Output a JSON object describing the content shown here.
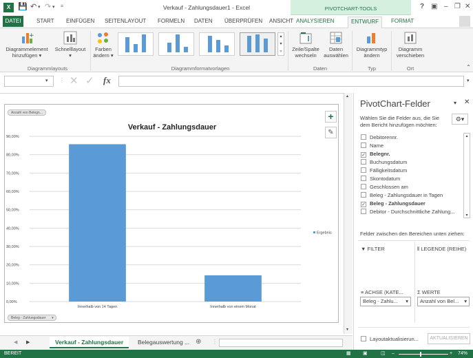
{
  "window": {
    "title": "Verkauf - Zahlungsdauer1 - Excel",
    "context_group": "PIVOTCHART-TOOLS",
    "help": "?"
  },
  "tabs": [
    "DATEI",
    "START",
    "EINFÜGEN",
    "SEITENLAYOUT",
    "FORMELN",
    "DATEN",
    "ÜBERPRÜFEN",
    "ANSICHT",
    "ANALYSIEREN",
    "ENTWURF",
    "FORMAT"
  ],
  "ribbon": {
    "btn_add_element": [
      "Diagrammelement",
      "hinzufügen ▾"
    ],
    "btn_quick_layout": [
      "Schnelllayout",
      "▾"
    ],
    "btn_colors": [
      "Farben",
      "ändern ▾"
    ],
    "btn_switch": [
      "Zeile/Spalte",
      "wechseln"
    ],
    "btn_select_data": [
      "Daten",
      "auswählen"
    ],
    "btn_change_type": [
      "Diagrammtyp",
      "ändern"
    ],
    "btn_move_chart": [
      "Diagramm",
      "verschieben"
    ],
    "groups": {
      "layouts": "Diagrammlayouts",
      "styles": "Diagrammformatvorlagen",
      "data": "Daten",
      "type": "Typ",
      "location": "Ort"
    }
  },
  "formula_bar": {
    "fx": "fx",
    "name_box": "",
    "value": ""
  },
  "chart": {
    "field_button_values": "Anzahl von Belegn...",
    "field_button_axis": "Beleg - Zahlungsdauer",
    "legend_label": "Ergebnis"
  },
  "chart_data": {
    "type": "bar",
    "title": "Verkauf - Zahlungsdauer",
    "categories": [
      "Innerhalb von 14 Tagen",
      "Innerhalb von einem Monat"
    ],
    "series": [
      {
        "name": "Ergebnis",
        "values": [
          85.7,
          14.3
        ],
        "color": "#5b9bd5"
      }
    ],
    "ylim": [
      0,
      90
    ],
    "yticks": [
      "0,00%",
      "10,00%",
      "20,00%",
      "30,00%",
      "40,00%",
      "50,00%",
      "60,00%",
      "70,00%",
      "80,00%",
      "90,00%"
    ],
    "grid": true,
    "legend": "right"
  },
  "sheet_tabs": {
    "active": "Verkauf - Zahlungsdauer",
    "other": "Belegauswertung ...",
    "add": "⊕"
  },
  "pivot_pane": {
    "title": "PivotChart-Felder",
    "subtitle": [
      "Wählen Sie die Felder aus, die Sie",
      "dem Bericht hinzufügen möchten:"
    ],
    "fields": [
      {
        "label": "Debitorennr.",
        "checked": false,
        "bold": false
      },
      {
        "label": "Name",
        "checked": false,
        "bold": false
      },
      {
        "label": "Belegnr.",
        "checked": true,
        "bold": true
      },
      {
        "label": "Buchungsdatum",
        "checked": false,
        "bold": false
      },
      {
        "label": "Fälligkeitsdatum",
        "checked": false,
        "bold": false
      },
      {
        "label": "Skontodatum",
        "checked": false,
        "bold": false
      },
      {
        "label": "Geschlossen am",
        "checked": false,
        "bold": false
      },
      {
        "label": "Beleg - Zahlungsdauer in Tagen",
        "checked": false,
        "bold": false
      },
      {
        "label": "Beleg - Zahlungsdauer",
        "checked": true,
        "bold": true
      },
      {
        "label": "Debitor - Durchschnittliche Zahlung...",
        "checked": false,
        "bold": false
      }
    ],
    "areas_hint": "Felder zwischen den Bereichen unten ziehen:",
    "filter": "FILTER",
    "legend": "LEGENDE (REIHE)",
    "axis": "ACHSE (KATE...",
    "values": "WERTE",
    "axis_item": "Beleg - Zahlu...",
    "values_item": "Anzahl von Bel...",
    "defer_label": "Layoutaktualisierun...",
    "update_button": "AKTUALISIEREN"
  },
  "status": {
    "mode": "BEREIT",
    "zoom": "74%"
  },
  "colors": {
    "excel_green": "#217346",
    "bar": "#5b9bd5"
  }
}
